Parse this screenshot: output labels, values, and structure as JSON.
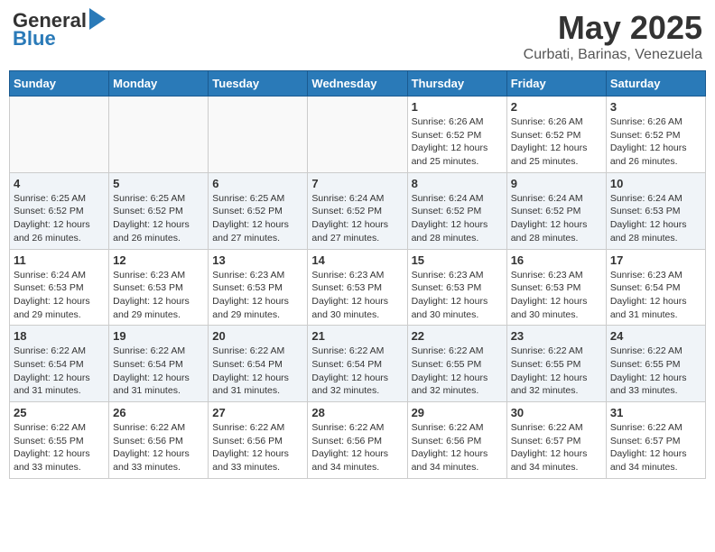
{
  "header": {
    "logo_general": "General",
    "logo_blue": "Blue",
    "month_year": "May 2025",
    "location": "Curbati, Barinas, Venezuela"
  },
  "weekdays": [
    "Sunday",
    "Monday",
    "Tuesday",
    "Wednesday",
    "Thursday",
    "Friday",
    "Saturday"
  ],
  "weeks": [
    [
      {
        "day": "",
        "info": ""
      },
      {
        "day": "",
        "info": ""
      },
      {
        "day": "",
        "info": ""
      },
      {
        "day": "",
        "info": ""
      },
      {
        "day": "1",
        "info": "Sunrise: 6:26 AM\nSunset: 6:52 PM\nDaylight: 12 hours\nand 25 minutes."
      },
      {
        "day": "2",
        "info": "Sunrise: 6:26 AM\nSunset: 6:52 PM\nDaylight: 12 hours\nand 25 minutes."
      },
      {
        "day": "3",
        "info": "Sunrise: 6:26 AM\nSunset: 6:52 PM\nDaylight: 12 hours\nand 26 minutes."
      }
    ],
    [
      {
        "day": "4",
        "info": "Sunrise: 6:25 AM\nSunset: 6:52 PM\nDaylight: 12 hours\nand 26 minutes."
      },
      {
        "day": "5",
        "info": "Sunrise: 6:25 AM\nSunset: 6:52 PM\nDaylight: 12 hours\nand 26 minutes."
      },
      {
        "day": "6",
        "info": "Sunrise: 6:25 AM\nSunset: 6:52 PM\nDaylight: 12 hours\nand 27 minutes."
      },
      {
        "day": "7",
        "info": "Sunrise: 6:24 AM\nSunset: 6:52 PM\nDaylight: 12 hours\nand 27 minutes."
      },
      {
        "day": "8",
        "info": "Sunrise: 6:24 AM\nSunset: 6:52 PM\nDaylight: 12 hours\nand 28 minutes."
      },
      {
        "day": "9",
        "info": "Sunrise: 6:24 AM\nSunset: 6:52 PM\nDaylight: 12 hours\nand 28 minutes."
      },
      {
        "day": "10",
        "info": "Sunrise: 6:24 AM\nSunset: 6:53 PM\nDaylight: 12 hours\nand 28 minutes."
      }
    ],
    [
      {
        "day": "11",
        "info": "Sunrise: 6:24 AM\nSunset: 6:53 PM\nDaylight: 12 hours\nand 29 minutes."
      },
      {
        "day": "12",
        "info": "Sunrise: 6:23 AM\nSunset: 6:53 PM\nDaylight: 12 hours\nand 29 minutes."
      },
      {
        "day": "13",
        "info": "Sunrise: 6:23 AM\nSunset: 6:53 PM\nDaylight: 12 hours\nand 29 minutes."
      },
      {
        "day": "14",
        "info": "Sunrise: 6:23 AM\nSunset: 6:53 PM\nDaylight: 12 hours\nand 30 minutes."
      },
      {
        "day": "15",
        "info": "Sunrise: 6:23 AM\nSunset: 6:53 PM\nDaylight: 12 hours\nand 30 minutes."
      },
      {
        "day": "16",
        "info": "Sunrise: 6:23 AM\nSunset: 6:53 PM\nDaylight: 12 hours\nand 30 minutes."
      },
      {
        "day": "17",
        "info": "Sunrise: 6:23 AM\nSunset: 6:54 PM\nDaylight: 12 hours\nand 31 minutes."
      }
    ],
    [
      {
        "day": "18",
        "info": "Sunrise: 6:22 AM\nSunset: 6:54 PM\nDaylight: 12 hours\nand 31 minutes."
      },
      {
        "day": "19",
        "info": "Sunrise: 6:22 AM\nSunset: 6:54 PM\nDaylight: 12 hours\nand 31 minutes."
      },
      {
        "day": "20",
        "info": "Sunrise: 6:22 AM\nSunset: 6:54 PM\nDaylight: 12 hours\nand 31 minutes."
      },
      {
        "day": "21",
        "info": "Sunrise: 6:22 AM\nSunset: 6:54 PM\nDaylight: 12 hours\nand 32 minutes."
      },
      {
        "day": "22",
        "info": "Sunrise: 6:22 AM\nSunset: 6:55 PM\nDaylight: 12 hours\nand 32 minutes."
      },
      {
        "day": "23",
        "info": "Sunrise: 6:22 AM\nSunset: 6:55 PM\nDaylight: 12 hours\nand 32 minutes."
      },
      {
        "day": "24",
        "info": "Sunrise: 6:22 AM\nSunset: 6:55 PM\nDaylight: 12 hours\nand 33 minutes."
      }
    ],
    [
      {
        "day": "25",
        "info": "Sunrise: 6:22 AM\nSunset: 6:55 PM\nDaylight: 12 hours\nand 33 minutes."
      },
      {
        "day": "26",
        "info": "Sunrise: 6:22 AM\nSunset: 6:56 PM\nDaylight: 12 hours\nand 33 minutes."
      },
      {
        "day": "27",
        "info": "Sunrise: 6:22 AM\nSunset: 6:56 PM\nDaylight: 12 hours\nand 33 minutes."
      },
      {
        "day": "28",
        "info": "Sunrise: 6:22 AM\nSunset: 6:56 PM\nDaylight: 12 hours\nand 34 minutes."
      },
      {
        "day": "29",
        "info": "Sunrise: 6:22 AM\nSunset: 6:56 PM\nDaylight: 12 hours\nand 34 minutes."
      },
      {
        "day": "30",
        "info": "Sunrise: 6:22 AM\nSunset: 6:57 PM\nDaylight: 12 hours\nand 34 minutes."
      },
      {
        "day": "31",
        "info": "Sunrise: 6:22 AM\nSunset: 6:57 PM\nDaylight: 12 hours\nand 34 minutes."
      }
    ]
  ]
}
